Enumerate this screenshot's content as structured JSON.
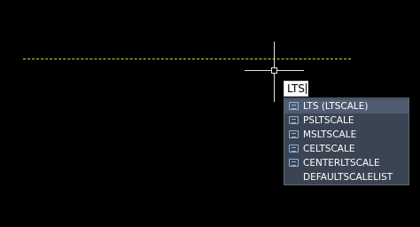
{
  "command_line": {
    "input_value": "LTS"
  },
  "autocomplete": {
    "items": [
      {
        "label": "LTS (LTSCALE)",
        "icon": "command-icon",
        "selected": true
      },
      {
        "label": "PSLTSCALE",
        "icon": "sysvar-icon"
      },
      {
        "label": "MSLTSCALE",
        "icon": "sysvar-icon"
      },
      {
        "label": "CELTSCALE",
        "icon": "sysvar-icon"
      },
      {
        "label": "CENTERLTSCALE",
        "icon": "sysvar-icon"
      },
      {
        "label": "DEFAULTSCALELIST",
        "icon": ""
      }
    ]
  },
  "colors": {
    "canvas_background": "#000000",
    "dashed_line": "#d8d83a",
    "crosshair": "#e6e6e6",
    "dropdown_background": "#3b4453",
    "dropdown_selected": "#4f5c72",
    "icon_accent": "#8fb2d8"
  }
}
